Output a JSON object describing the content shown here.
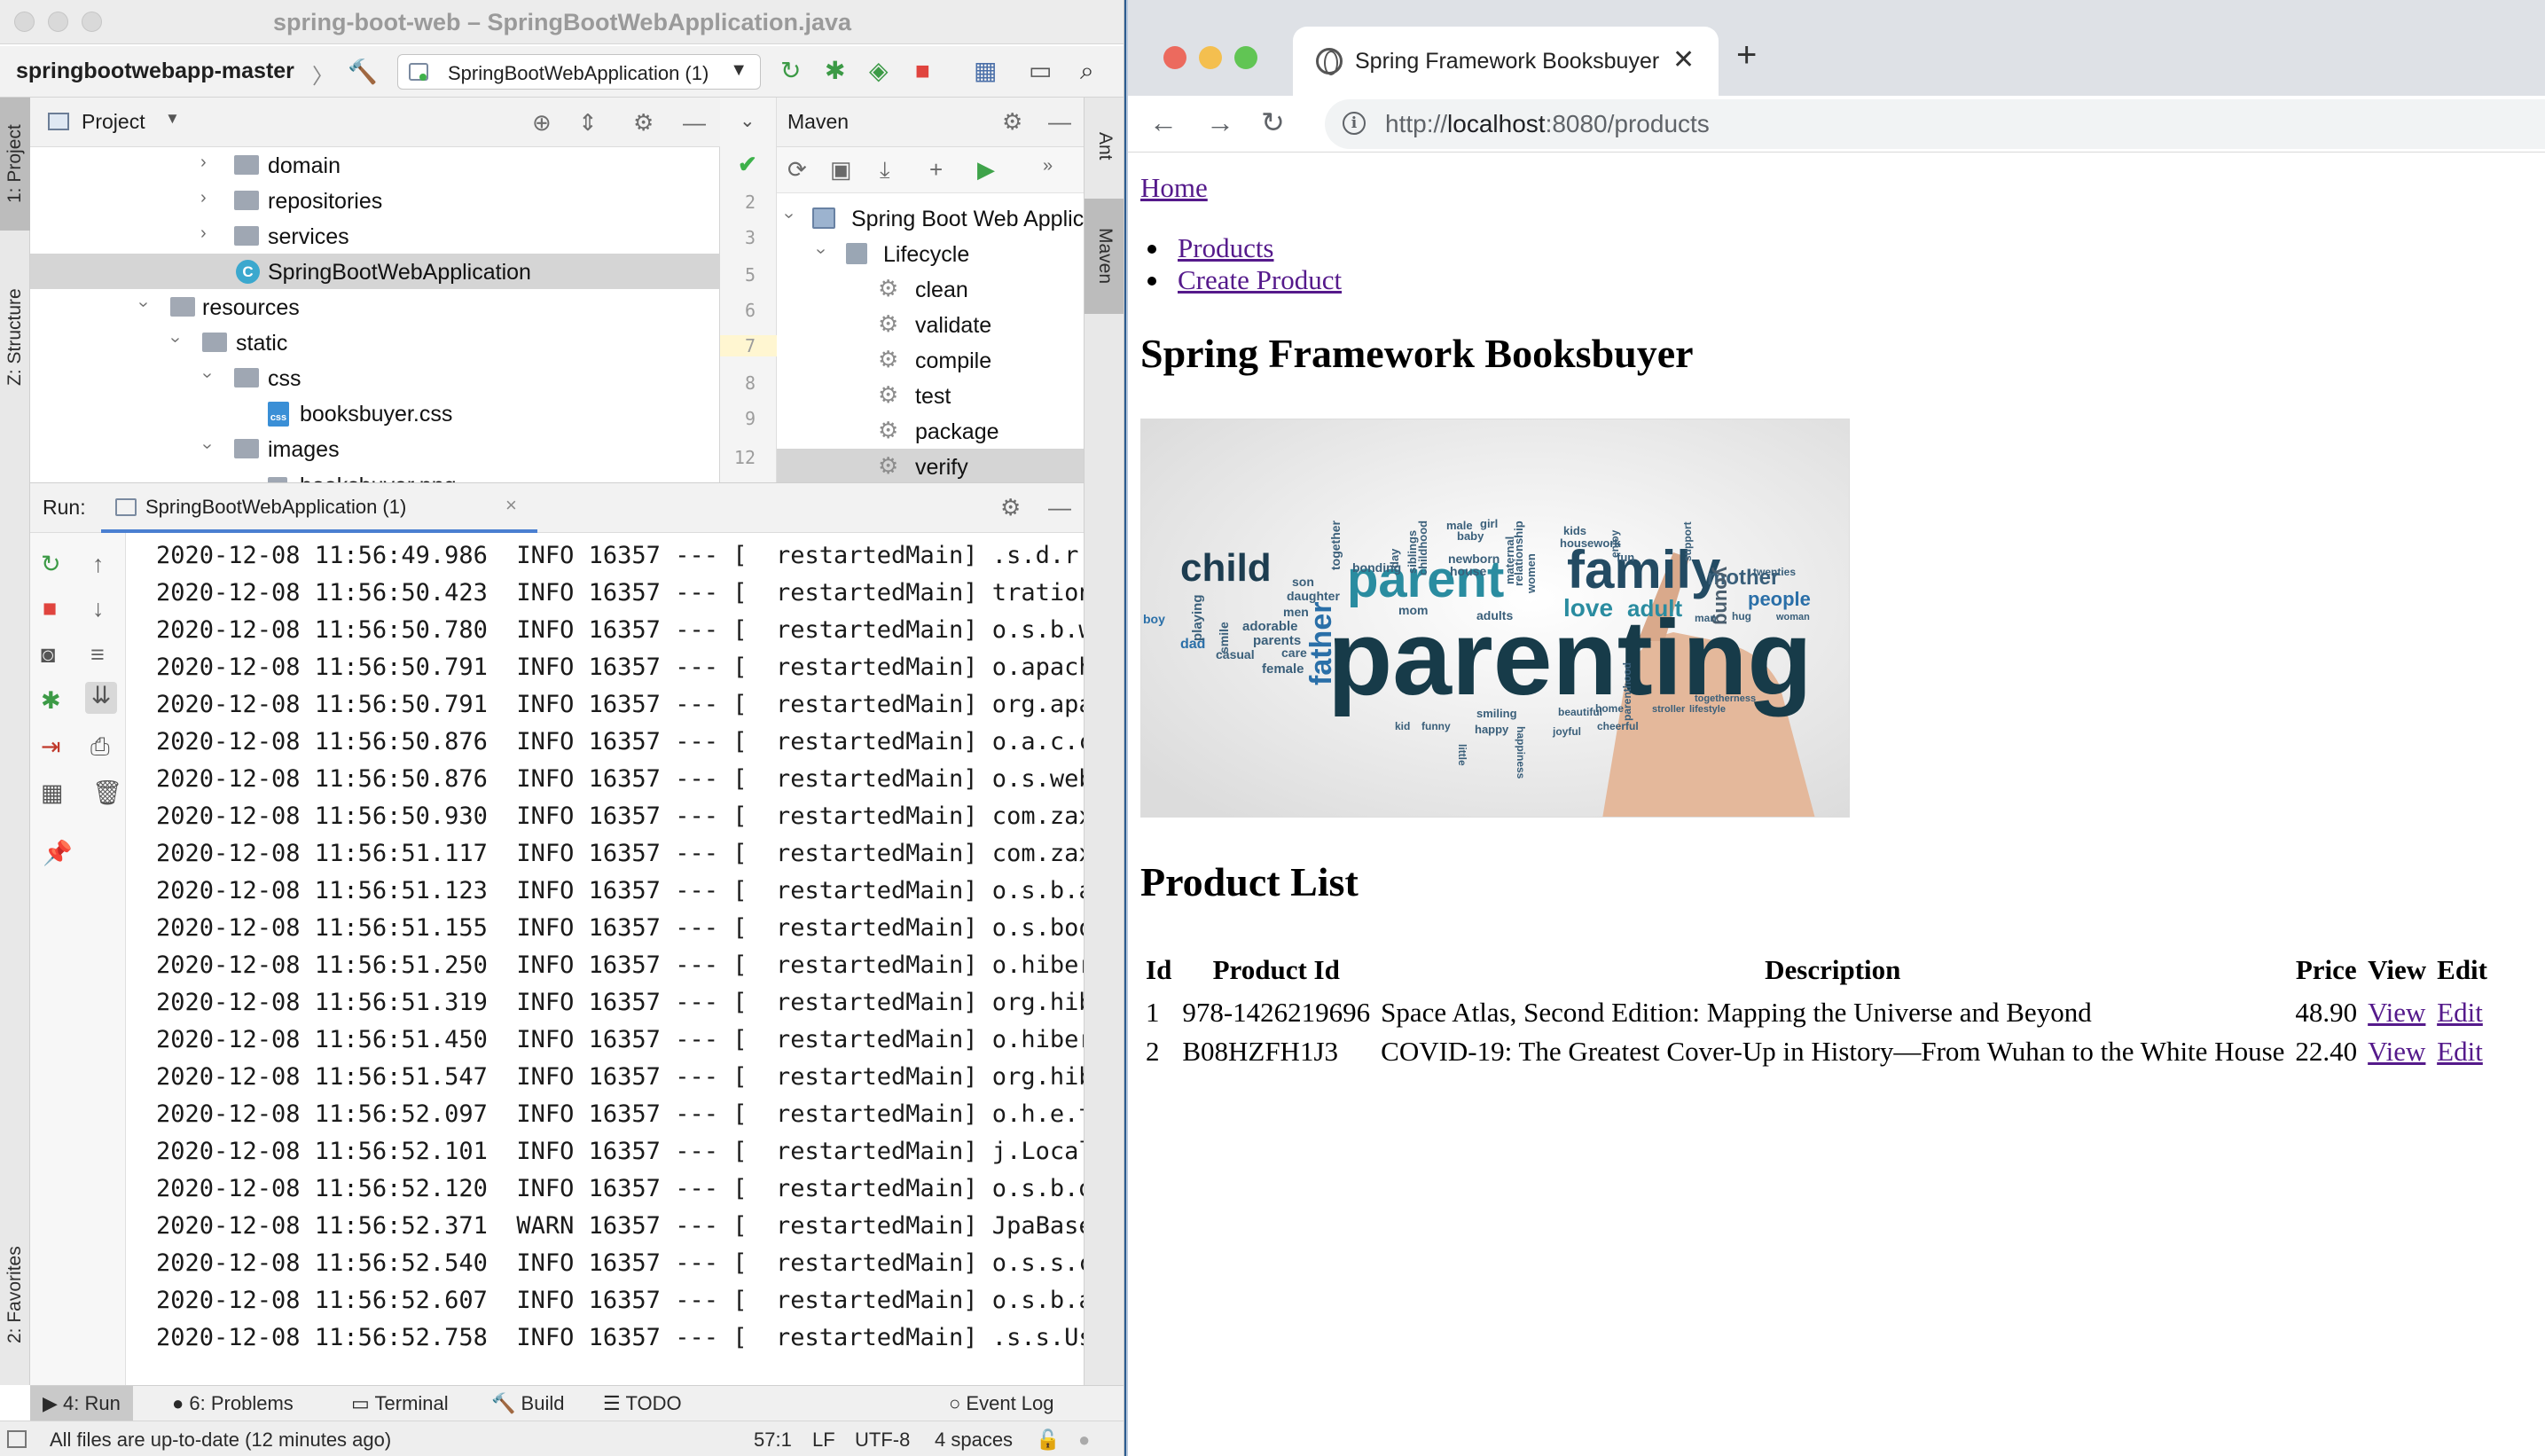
{
  "ide": {
    "window_title": "spring-boot-web – SpringBootWebApplication.java",
    "breadcrumb_project": "springbootwebapp-master",
    "breadcrumb_separator": "〉",
    "run_config": "SpringBootWebApplication (1)",
    "left_tabs": {
      "project": "1: Project",
      "structure": "Z: Structure",
      "favorites": "2: Favorites"
    },
    "right_tabs": {
      "ant": "Ant",
      "maven": "Maven"
    },
    "project_panel": {
      "title": "Project",
      "tree": [
        {
          "label": "domain",
          "type": "folder",
          "expanded": false
        },
        {
          "label": "repositories",
          "type": "folder",
          "expanded": false
        },
        {
          "label": "services",
          "type": "folder",
          "expanded": false
        },
        {
          "label": "SpringBootWebApplication",
          "type": "java",
          "selected": true
        },
        {
          "label": "resources",
          "type": "folder",
          "expanded": true
        },
        {
          "label": "static",
          "type": "folder",
          "expanded": true
        },
        {
          "label": "css",
          "type": "folder",
          "expanded": true
        },
        {
          "label": "booksbuyer.css",
          "type": "css"
        },
        {
          "label": "images",
          "type": "folder",
          "expanded": true
        },
        {
          "label": "booksbuyer.png",
          "type": "file"
        }
      ]
    },
    "gutter_lines": [
      "2",
      "3",
      "5",
      "6",
      "7",
      "8",
      "9",
      "12"
    ],
    "maven_panel": {
      "title": "Maven",
      "project": "Spring Boot Web Application",
      "lifecycle": "Lifecycle",
      "goals": [
        "clean",
        "validate",
        "compile",
        "test",
        "package",
        "verify"
      ],
      "selected_goal": "verify"
    },
    "run_panel": {
      "label": "Run:",
      "tab": "SpringBootWebApplication (1)",
      "log": [
        "2020-12-08 11:56:49.986  INFO 16357 --- [  restartedMain] .s.d.r.c",
        "2020-12-08 11:56:50.423  INFO 16357 --- [  restartedMain] trationD",
        "2020-12-08 11:56:50.780  INFO 16357 --- [  restartedMain] o.s.b.w.",
        "2020-12-08 11:56:50.791  INFO 16357 --- [  restartedMain] o.apache",
        "2020-12-08 11:56:50.791  INFO 16357 --- [  restartedMain] org.apac",
        "2020-12-08 11:56:50.876  INFO 16357 --- [  restartedMain] o.a.c.c.",
        "2020-12-08 11:56:50.876  INFO 16357 --- [  restartedMain] o.s.web.",
        "2020-12-08 11:56:50.930  INFO 16357 --- [  restartedMain] com.zaxx",
        "2020-12-08 11:56:51.117  INFO 16357 --- [  restartedMain] com.zaxx",
        "2020-12-08 11:56:51.123  INFO 16357 --- [  restartedMain] o.s.b.a.",
        "2020-12-08 11:56:51.155  INFO 16357 --- [  restartedMain] o.s.boot",
        "2020-12-08 11:56:51.250  INFO 16357 --- [  restartedMain] o.hibern",
        "2020-12-08 11:56:51.319  INFO 16357 --- [  restartedMain] org.hibe",
        "2020-12-08 11:56:51.450  INFO 16357 --- [  restartedMain] o.hibern",
        "2020-12-08 11:56:51.547  INFO 16357 --- [  restartedMain] org.hibe",
        "2020-12-08 11:56:52.097  INFO 16357 --- [  restartedMain] o.h.e.t.",
        "2020-12-08 11:56:52.101  INFO 16357 --- [  restartedMain] j.LocalC",
        "2020-12-08 11:56:52.120  INFO 16357 --- [  restartedMain] o.s.b.d.",
        "2020-12-08 11:56:52.371  WARN 16357 --- [  restartedMain] JpaBaseC",
        "2020-12-08 11:56:52.540  INFO 16357 --- [  restartedMain] o.s.s.co",
        "2020-12-08 11:56:52.607  INFO 16357 --- [  restartedMain] o.s.b.a.",
        "2020-12-08 11:56:52.758  INFO 16357 --- [  restartedMain] .s.s.Use"
      ]
    },
    "bottom_tabs": {
      "run": "4: Run",
      "problems": "6: Problems",
      "terminal": "Terminal",
      "build": "Build",
      "todo": "TODO",
      "event_log": "Event Log"
    },
    "status": {
      "message": "All files are up-to-date (12 minutes ago)",
      "position": "57:1",
      "line_sep": "LF",
      "encoding": "UTF-8",
      "indent": "4 spaces"
    }
  },
  "browser": {
    "tab_title": "Spring Framework Booksbuyer",
    "new_tab": "+",
    "url_prefix": "http://",
    "url_host": "localhost",
    "url_rest": ":8080/products",
    "page": {
      "home": "Home",
      "nav": [
        "Products",
        "Create Product"
      ],
      "heading": "Spring Framework Booksbuyer",
      "list_heading": "Product List",
      "table": {
        "headers": [
          "Id",
          "Product Id",
          "Description",
          "Price",
          "View",
          "Edit"
        ],
        "rows": [
          {
            "id": "1",
            "product_id": "978-1426219696",
            "description": "Space Atlas, Second Edition: Mapping the Universe and Beyond",
            "price": "48.90",
            "view": "View",
            "edit": "Edit"
          },
          {
            "id": "2",
            "product_id": "B08HZFH1J3",
            "description": "COVID-19: The Greatest Cover-Up in History—From Wuhan to the White House",
            "price": "22.40",
            "view": "View",
            "edit": "Edit"
          }
        ]
      },
      "word_cloud": {
        "words": [
          "child",
          "parent",
          "family",
          "parenting",
          "father",
          "love",
          "adult",
          "mother",
          "people",
          "young",
          "son",
          "daughter",
          "men",
          "adorable",
          "parents",
          "care",
          "female",
          "casual",
          "dad",
          "playing",
          "smile",
          "bonding",
          "together",
          "mom",
          "adults",
          "newborn",
          "house",
          "baby",
          "male",
          "girl",
          "kids",
          "housework",
          "fun",
          "women",
          "relationship",
          "maternal",
          "childhood",
          "siblings",
          "day",
          "support",
          "enjoy",
          "twenties",
          "hug",
          "woman",
          "man",
          "lifestyle",
          "togetherness",
          "stroller",
          "parenthood",
          "home",
          "beautiful",
          "cheerful",
          "joyful",
          "happiness",
          "happy",
          "smiling",
          "kid",
          "funny",
          "little",
          "boy"
        ]
      }
    }
  }
}
